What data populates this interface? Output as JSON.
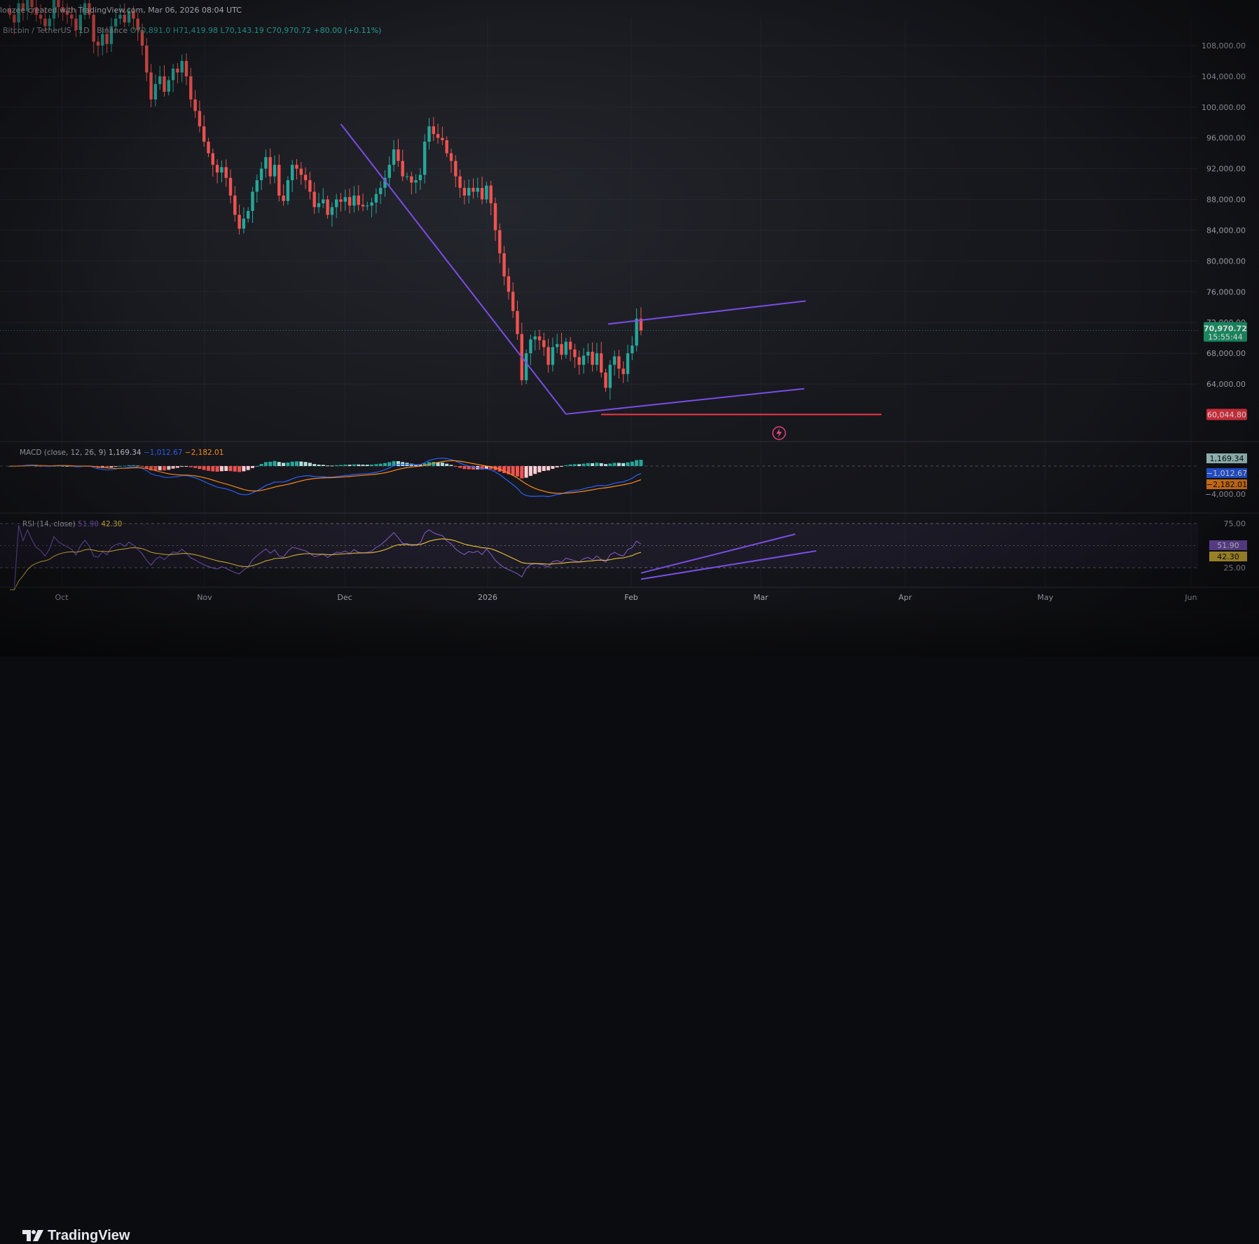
{
  "header": {
    "author_line": "lonzee created with TradingView.com, Mar 06, 2026 08:04 UTC",
    "symbol": "Bitcoin / TetherUS · 1D · Binance",
    "ohlc": "O70,891.0   H71,419.98  L70,143.19  C70,970.72  +80.00 (+0.11%)"
  },
  "price_axis": {
    "ticks": [
      "108,000.00",
      "104,000.00",
      "100,000.00",
      "96,000.00",
      "92,000.00",
      "88,000.00",
      "84,000.00",
      "80,000.00",
      "76,000.00",
      "72,000.00",
      "68,000.00",
      "64,000.00"
    ],
    "last_price": "70,970.72",
    "countdown": "15:55:44",
    "support_label": "60,044.80"
  },
  "time_axis": [
    "Oct",
    "Nov",
    "Dec",
    "2026",
    "Feb",
    "Mar",
    "Apr",
    "May",
    "Jun"
  ],
  "macd": {
    "legend_name": "MACD (close, 12, 26, 9)",
    "hist_value": "1,169.34",
    "macd_value": "−1,012.67",
    "signal_value": "−2,182.01",
    "axis_ticks": [
      "1,169.34",
      "−1,012.67",
      "−2,182.01",
      "−4,000.00"
    ]
  },
  "rsi": {
    "legend_name": "RSI (14, close)",
    "rsi_value": "51.90",
    "ma_value": "42.30",
    "axis_ticks": [
      "75.00",
      "51.90",
      "42.30",
      "25.00"
    ]
  },
  "branding": {
    "logo_text": "TradingView"
  },
  "colors": {
    "up": "#26a69a",
    "down": "#ef5350",
    "trendline": "#7b4de8",
    "support": "#f23645",
    "macd": "#2962ff",
    "signal": "#ff8a1e",
    "rsi": "#7e57c2",
    "rsi_ma": "#e9c43b"
  },
  "chart_data": {
    "type": "candlestick",
    "title": "Bitcoin / TetherUS · 1D · Binance",
    "ylim": [
      58000,
      110000
    ],
    "x_labels": [
      "Oct",
      "Nov",
      "Dec",
      "2026",
      "Feb",
      "Mar",
      "Apr",
      "May",
      "Jun"
    ],
    "closes": [
      112000,
      111000,
      113500,
      112500,
      114000,
      113000,
      112000,
      111500,
      110500,
      111500,
      114000,
      113000,
      112500,
      112000,
      111500,
      110000,
      112000,
      113500,
      112000,
      108500,
      108000,
      109500,
      108200,
      110500,
      111500,
      112000,
      111000,
      112500,
      111500,
      110000,
      108000,
      104500,
      101000,
      103000,
      104000,
      102000,
      103500,
      105000,
      104500,
      106000,
      104000,
      101000,
      99500,
      97500,
      95500,
      94000,
      92500,
      91500,
      92200,
      90800,
      88500,
      86000,
      84200,
      85500,
      86500,
      89000,
      90500,
      92000,
      93500,
      91000,
      92500,
      88500,
      87800,
      90500,
      92500,
      92000,
      91200,
      90500,
      89000,
      87000,
      87500,
      88000,
      86000,
      87000,
      88000,
      87700,
      88300,
      87200,
      88500,
      87300,
      87100,
      87200,
      87600,
      88700,
      89500,
      90800,
      92500,
      94500,
      93000,
      91000,
      91000,
      90200,
      90500,
      91200,
      95500,
      97500,
      96500,
      96000,
      95700,
      94000,
      93000,
      91000,
      89500,
      88500,
      89500,
      89000,
      89500,
      88000,
      89800,
      87500,
      84000,
      81000,
      78000,
      76000,
      73500,
      70500,
      64500,
      68000,
      69800,
      70200,
      69700,
      68800,
      66500,
      68800,
      69200,
      67800,
      69500,
      68500,
      67500,
      66500,
      67700,
      68200,
      66500,
      68000,
      65500,
      63500,
      66500,
      67600,
      66000,
      65300,
      68000,
      69000,
      72500,
      70970
    ],
    "support": 60044.8,
    "macd_last": {
      "histogram": 1169.34,
      "macd": -1012.67,
      "signal": -2182.01
    },
    "rsi_last": {
      "rsi": 51.9,
      "ma": 42.3
    }
  }
}
